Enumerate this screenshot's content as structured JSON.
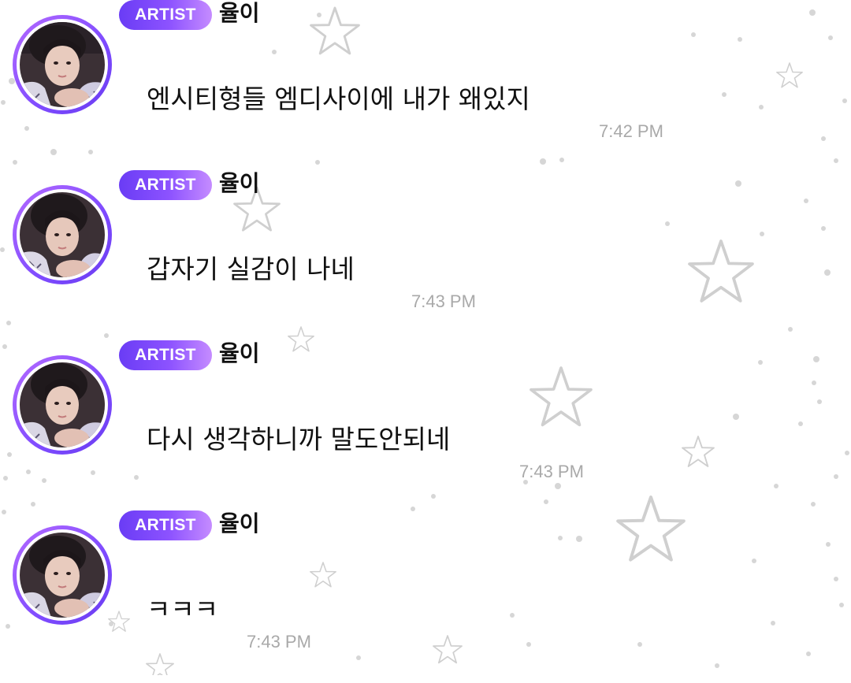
{
  "messages": [
    {
      "badge": "ARTIST",
      "name": "율이",
      "text": "엔시티형들 엠디사이에 내가 왜있지",
      "time": "7:42 PM"
    },
    {
      "badge": "ARTIST",
      "name": "율이",
      "text": "갑자기 실감이 나네",
      "time": "7:43 PM"
    },
    {
      "badge": "ARTIST",
      "name": "율이",
      "text": "다시 생각하니까 말도안되네",
      "time": "7:43 PM"
    },
    {
      "badge": "ARTIST",
      "name": "율이",
      "text": "ㅋㅋㅋ",
      "time": "7:43 PM"
    }
  ],
  "colors": {
    "badge_gradient_start": "#6a3cf5",
    "badge_gradient_end": "#c58cff",
    "avatar_ring": "#8a52ff",
    "timestamp": "#a9a9a9",
    "message_text": "#111111"
  },
  "icons": {
    "background_pattern": "star-pattern",
    "avatar": "user-avatar-photo"
  }
}
